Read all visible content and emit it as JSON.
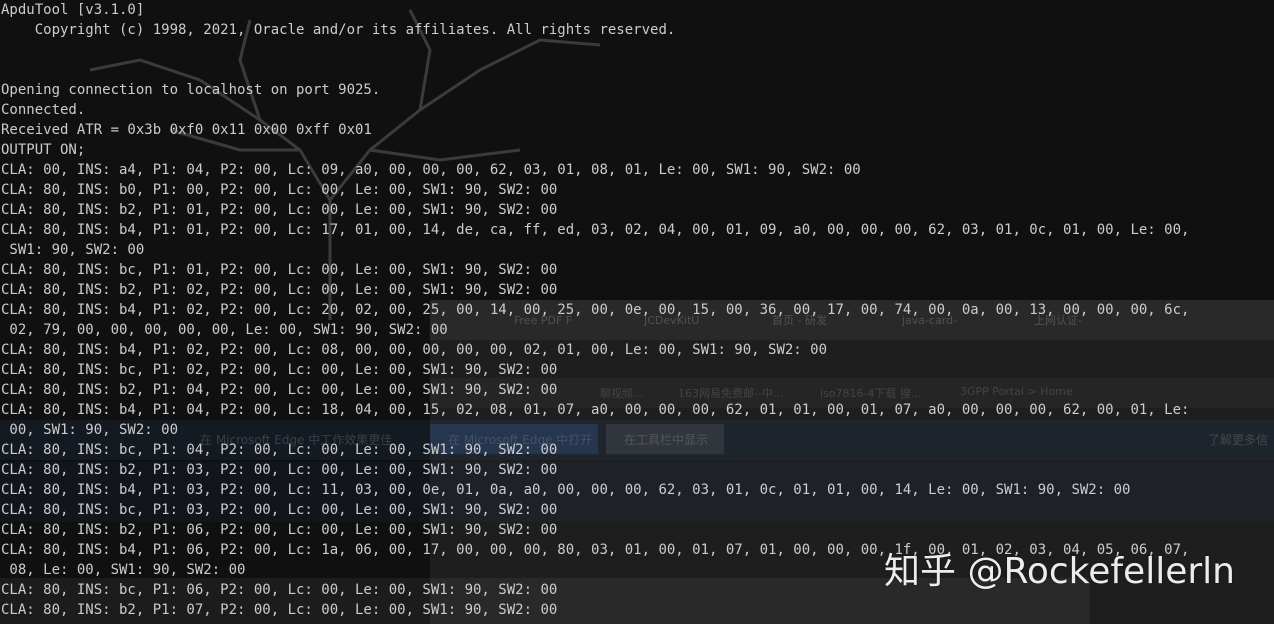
{
  "console": {
    "lines": [
      "ApduTool [v3.1.0]",
      "    Copyright (c) 1998, 2021, Oracle and/or its affiliates. All rights reserved.",
      "",
      "",
      "Opening connection to localhost on port 9025.",
      "Connected.",
      "Received ATR = 0x3b 0xf0 0x11 0x00 0xff 0x01",
      "OUTPUT ON;",
      "CLA: 00, INS: a4, P1: 04, P2: 00, Lc: 09, a0, 00, 00, 00, 62, 03, 01, 08, 01, Le: 00, SW1: 90, SW2: 00",
      "CLA: 80, INS: b0, P1: 00, P2: 00, Lc: 00, Le: 00, SW1: 90, SW2: 00",
      "CLA: 80, INS: b2, P1: 01, P2: 00, Lc: 00, Le: 00, SW1: 90, SW2: 00",
      "CLA: 80, INS: b4, P1: 01, P2: 00, Lc: 17, 01, 00, 14, de, ca, ff, ed, 03, 02, 04, 00, 01, 09, a0, 00, 00, 00, 62, 03, 01, 0c, 01, 00, Le: 00,",
      " SW1: 90, SW2: 00",
      "CLA: 80, INS: bc, P1: 01, P2: 00, Lc: 00, Le: 00, SW1: 90, SW2: 00",
      "CLA: 80, INS: b2, P1: 02, P2: 00, Lc: 00, Le: 00, SW1: 90, SW2: 00",
      "CLA: 80, INS: b4, P1: 02, P2: 00, Lc: 20, 02, 00, 25, 00, 14, 00, 25, 00, 0e, 00, 15, 00, 36, 00, 17, 00, 74, 00, 0a, 00, 13, 00, 00, 00, 6c,",
      " 02, 79, 00, 00, 00, 00, 00, Le: 00, SW1: 90, SW2: 00",
      "CLA: 80, INS: b4, P1: 02, P2: 00, Lc: 08, 00, 00, 00, 00, 00, 02, 01, 00, Le: 00, SW1: 90, SW2: 00",
      "CLA: 80, INS: bc, P1: 02, P2: 00, Lc: 00, Le: 00, SW1: 90, SW2: 00",
      "CLA: 80, INS: b2, P1: 04, P2: 00, Lc: 00, Le: 00, SW1: 90, SW2: 00",
      "CLA: 80, INS: b4, P1: 04, P2: 00, Lc: 18, 04, 00, 15, 02, 08, 01, 07, a0, 00, 00, 00, 62, 01, 01, 00, 01, 07, a0, 00, 00, 00, 62, 00, 01, Le:",
      " 00, SW1: 90, SW2: 00",
      "CLA: 80, INS: bc, P1: 04, P2: 00, Lc: 00, Le: 00, SW1: 90, SW2: 00",
      "CLA: 80, INS: b2, P1: 03, P2: 00, Lc: 00, Le: 00, SW1: 90, SW2: 00",
      "CLA: 80, INS: b4, P1: 03, P2: 00, Lc: 11, 03, 00, 0e, 01, 0a, a0, 00, 00, 00, 62, 03, 01, 0c, 01, 01, 00, 14, Le: 00, SW1: 90, SW2: 00",
      "CLA: 80, INS: bc, P1: 03, P2: 00, Lc: 00, Le: 00, SW1: 90, SW2: 00",
      "CLA: 80, INS: b2, P1: 06, P2: 00, Lc: 00, Le: 00, SW1: 90, SW2: 00",
      "CLA: 80, INS: b4, P1: 06, P2: 00, Lc: 1a, 06, 00, 17, 00, 00, 00, 80, 03, 01, 00, 01, 07, 01, 00, 00, 00, 1f, 00, 01, 02, 03, 04, 05, 06, 07,",
      " 08, Le: 00, SW1: 90, SW2: 00",
      "CLA: 80, INS: bc, P1: 06, P2: 00, Lc: 00, Le: 00, SW1: 90, SW2: 00",
      "CLA: 80, INS: b2, P1: 07, P2: 00, Lc: 00, Le: 00, SW1: 90, SW2: 00"
    ],
    "text_color": "#cccccc",
    "background_color": "#101010"
  },
  "background": {
    "tabs": [
      "Free PDF F",
      "JCDevKitU",
      "首页 - 研发",
      "java-card-",
      "上网认证-"
    ],
    "bookmarks": [
      "聊视频...",
      "163网易免费邮--中...",
      "iso7816-4下载 搜...",
      "3GPP Portal > Home"
    ],
    "infobar_text": "在 Microsoft Edge 中工作效果更佳",
    "infobar_button_primary": "在 Microsoft Edge 中打开",
    "infobar_button_secondary": "在工具栏中显示",
    "infobar_link": "了解更多信"
  },
  "watermark": {
    "text": "知乎 @Rockefellerln"
  }
}
